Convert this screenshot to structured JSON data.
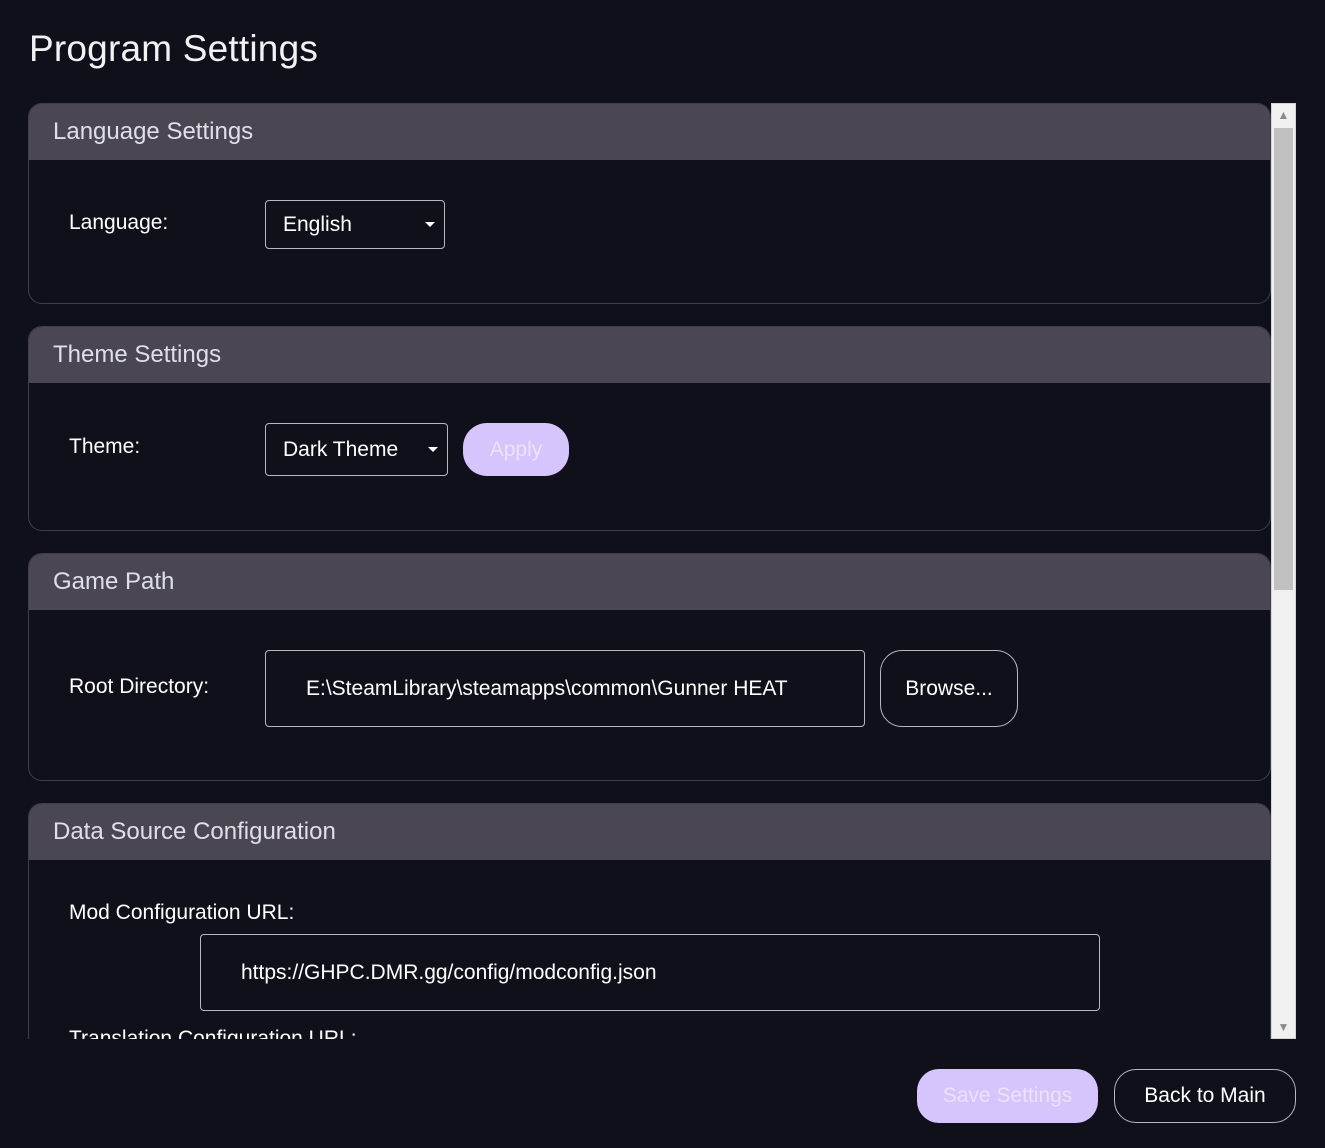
{
  "page": {
    "title": "Program Settings"
  },
  "language_settings": {
    "header": "Language Settings",
    "label": "Language:",
    "selected": "English"
  },
  "theme_settings": {
    "header": "Theme Settings",
    "label": "Theme:",
    "selected": "Dark Theme",
    "apply_label": "Apply"
  },
  "game_path": {
    "header": "Game Path",
    "label": "Root Directory:",
    "value": "E:\\SteamLibrary\\steamapps\\common\\Gunner HEAT",
    "browse_label": "Browse..."
  },
  "data_source": {
    "header": "Data Source Configuration",
    "mod_config_label": "Mod Configuration URL:",
    "mod_config_value": "https://GHPC.DMR.gg/config/modconfig.json",
    "translation_config_label": "Translation Configuration URL:"
  },
  "footer": {
    "save_label": "Save Settings",
    "back_label": "Back to Main"
  },
  "colors": {
    "background": "#10101a",
    "group_header": "#4a4753",
    "accent_button": "#d6c4fc"
  },
  "icons": {
    "dropdown": "chevron-down-icon",
    "scroll_up": "scroll-up-icon",
    "scroll_down": "scroll-down-icon"
  }
}
